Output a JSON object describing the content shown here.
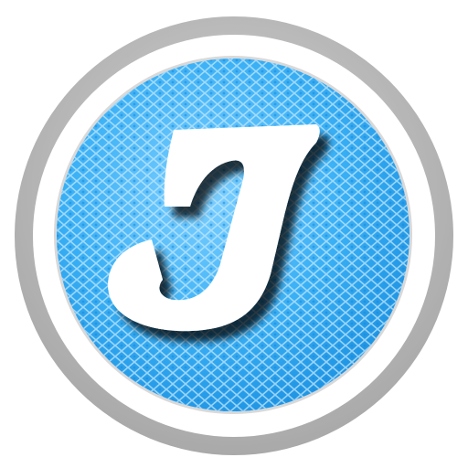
{
  "icon": {
    "name": "letter-j-app-icon",
    "glyph": "J",
    "colors": {
      "background": "#ffffff",
      "outer_ring": "#bdbdbd",
      "inner_ring": "#ffffff",
      "disc_light": "#7fd0ff",
      "disc_mid": "#3ab0f5",
      "disc_dark": "#1a8fe0",
      "mesh_highlight": "#bfe7ff",
      "letter_fill": "#ffffff",
      "letter_shadow": "#5a5a5a"
    }
  }
}
